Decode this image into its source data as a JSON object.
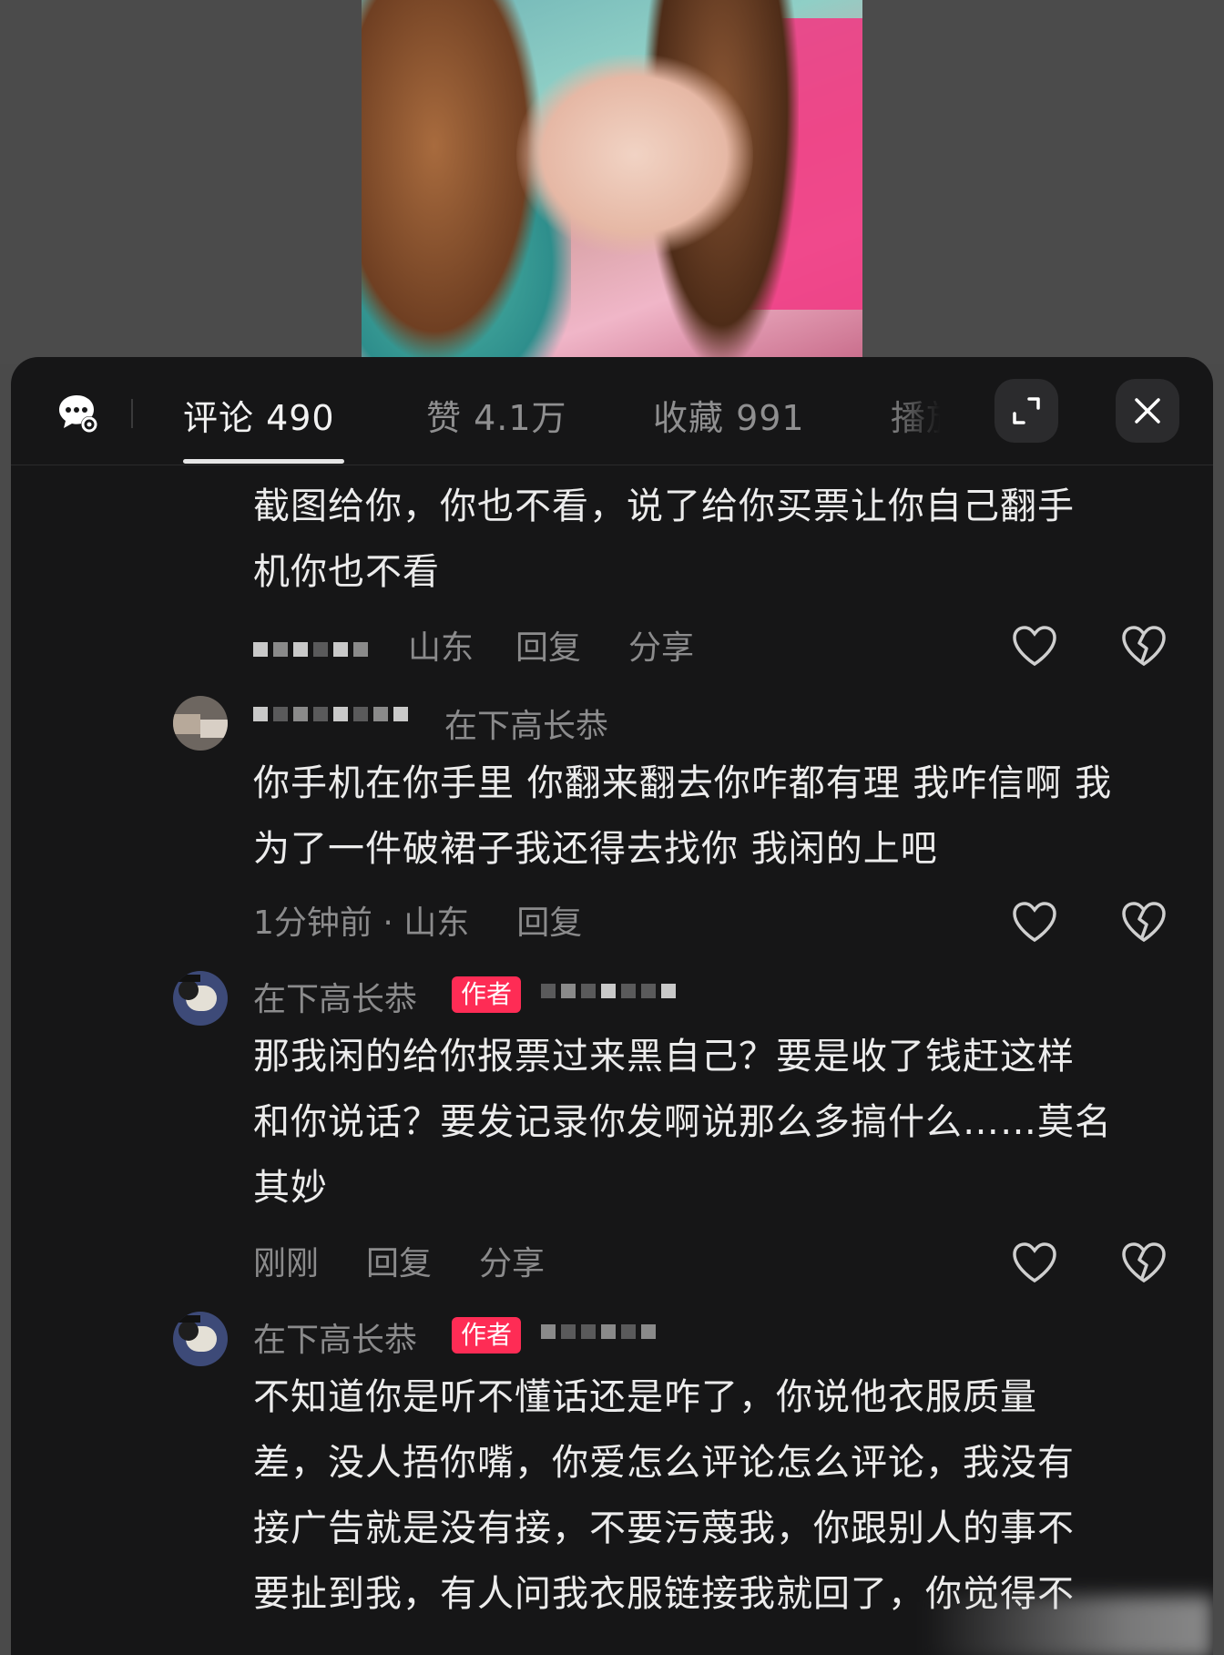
{
  "tabs": [
    {
      "label": "评论 490",
      "active": true
    },
    {
      "label": "赞 4.1万",
      "active": false
    },
    {
      "label": "收藏 991",
      "active": false
    },
    {
      "label": "播放",
      "active": false
    }
  ],
  "icons": {
    "comment_settings": "comment-settings-icon",
    "expand": "expand-icon",
    "close": "close-icon",
    "like": "heart-icon",
    "dislike": "broken-heart-icon"
  },
  "colors": {
    "panel_bg": "#161617",
    "author_badge": "#fe2c55",
    "text_primary": "#ececec",
    "text_secondary": "#8b8b8c"
  },
  "comments": [
    {
      "text_lines": [
        "截图给你，你也不看，说了给你买票让你自己翻手",
        "机你也不看"
      ],
      "location": "山东",
      "reply_label": "回复",
      "share_label": "分享"
    },
    {
      "username": "在下高长恭",
      "text_lines": [
        "你手机在你手里 你翻来翻去你咋都有理 我咋信啊 我",
        "为了一件破裙子我还得去找你 我闲的上吧"
      ],
      "time_location": "1分钟前 · 山东",
      "reply_label": "回复"
    },
    {
      "username": "在下高长恭",
      "badge": "作者",
      "text_lines": [
        "那我闲的给你报票过来黑自己？要是收了钱赶这样",
        "和你说话？要发记录你发啊说那么多搞什么……莫名",
        "其妙"
      ],
      "time": "刚刚",
      "reply_label": "回复",
      "share_label": "分享"
    },
    {
      "username": "在下高长恭",
      "badge": "作者",
      "text_lines": [
        "不知道你是听不懂话还是咋了，你说他衣服质量",
        "差，没人捂你嘴，你爱怎么评论怎么评论，我没有",
        "接广告就是没有接，不要污蔑我，你跟别人的事不",
        "要扯到我，有人问我衣服链接我就回了，你觉得不"
      ]
    }
  ]
}
